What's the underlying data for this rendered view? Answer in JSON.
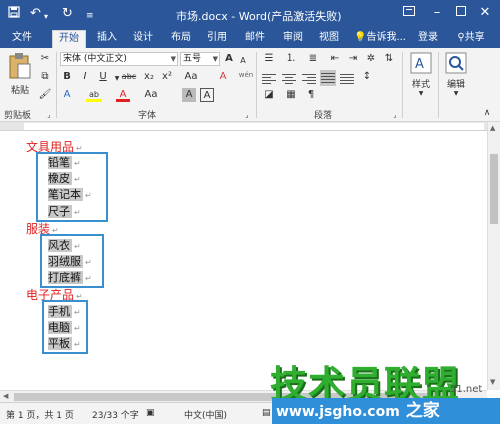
{
  "window": {
    "title": "市场.docx - Word(产品激活失败)"
  },
  "tabs": [
    {
      "label": "文件"
    },
    {
      "label": "开始"
    },
    {
      "label": "插入"
    },
    {
      "label": "设计"
    },
    {
      "label": "布局"
    },
    {
      "label": "引用"
    },
    {
      "label": "邮件"
    },
    {
      "label": "审阅"
    },
    {
      "label": "视图"
    }
  ],
  "tell_me": "告诉我...",
  "login": "登录",
  "share": "共享",
  "ribbon": {
    "paste_label": "粘贴",
    "clipboard_group": "剪贴板",
    "font_name": "宋体 (中文正文)",
    "font_size": "五号",
    "font_group": "字体",
    "paragraph_group": "段落",
    "styles_label": "样式",
    "editing_label": "编辑",
    "format_buttons": {
      "bold": "B",
      "italic": "I",
      "underline": "U",
      "strike": "abc",
      "subscript": "x₂",
      "superscript": "x²",
      "change_case": "Aa",
      "grow": "A",
      "shrink": "A",
      "phonetic": "wén",
      "char_border": "A",
      "font_color": "A",
      "highlight": "ab",
      "char_shading": "A",
      "clear": "A"
    },
    "colors": {
      "font_color": "#e02020",
      "highlight": "#ffff00"
    }
  },
  "document": {
    "sections": [
      {
        "heading": "文具用品",
        "items": [
          "铅笔",
          "橡皮",
          "笔记本",
          "尺子"
        ]
      },
      {
        "heading": "服装",
        "items": [
          "风衣",
          "羽绒服",
          "打底裤"
        ]
      },
      {
        "heading": "电子产品",
        "items": [
          "手机",
          "电脑",
          "平板"
        ]
      }
    ],
    "paragraph_mark": "↵",
    "heading_color": "#e02020",
    "box_color": "#3a8fd0"
  },
  "statusbar": {
    "page": "第 1 页，共 1 页",
    "words": "23/33 个字",
    "language": "中文(中国)"
  },
  "watermark": {
    "brand": "技术员联盟",
    "url": "www.jsgho.com",
    "suffix": "之家",
    "small": "51.net"
  }
}
